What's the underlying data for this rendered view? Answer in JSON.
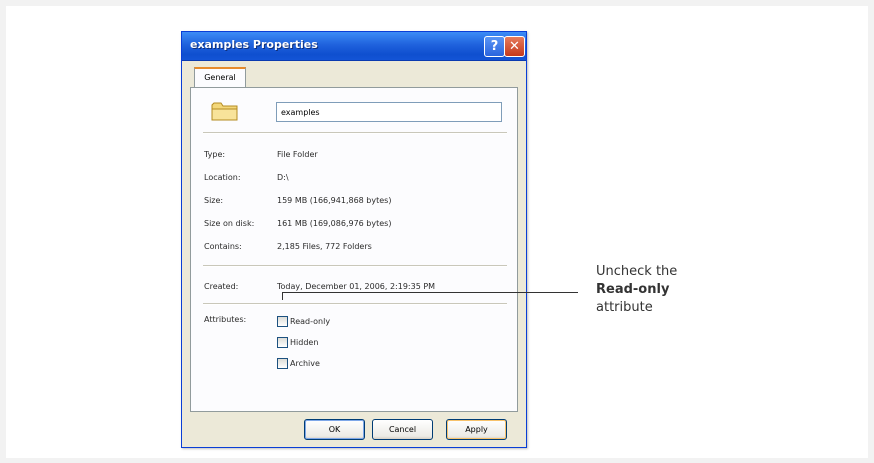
{
  "dialog": {
    "title": "examples Properties",
    "help_label": "?",
    "close_label": "✕",
    "tab_label": "General",
    "folder_name": "examples",
    "props": [
      {
        "label": "Type:",
        "value": "File Folder"
      },
      {
        "label": "Location:",
        "value": "D:\\"
      },
      {
        "label": "Size:",
        "value": "159 MB (166,941,868 bytes)"
      },
      {
        "label": "Size on disk:",
        "value": "161 MB (169,086,976 bytes)"
      },
      {
        "label": "Contains:",
        "value": "2,185 Files, 772 Folders"
      }
    ],
    "created": {
      "label": "Created:",
      "value": "Today, December 01, 2006, 2:19:35 PM"
    },
    "attributes_label": "Attributes:",
    "attributes": [
      {
        "label": "Read-only",
        "checked": false
      },
      {
        "label": "Hidden",
        "checked": false
      },
      {
        "label": "Archive",
        "checked": false
      }
    ],
    "buttons": {
      "ok": "OK",
      "cancel": "Cancel",
      "apply": "Apply"
    }
  },
  "callout": {
    "line1": "Uncheck the",
    "line2": "Read-only",
    "line3": "attribute"
  },
  "colors": {
    "titlebar": "#0f4fcf",
    "dialog_bg": "#ece9d8",
    "tab_accent": "#e68b2c"
  }
}
